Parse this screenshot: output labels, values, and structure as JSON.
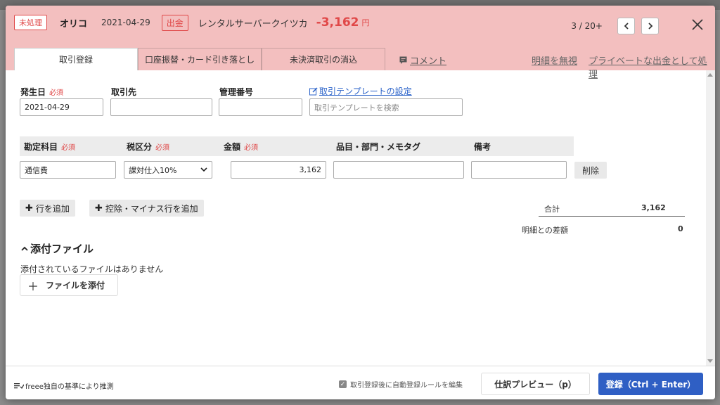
{
  "header": {
    "status_badge": "未処理",
    "partner": "オリコ",
    "date": "2021-04-29",
    "direction": "出金",
    "description": "レンタルサーバークイツカ",
    "amount": "-3,162",
    "currency": "円",
    "pager": "3 / 20+",
    "colors": {
      "header_bg": "#f3bfbf",
      "accent_red": "#e04848"
    }
  },
  "tabs": [
    {
      "label": "取引登録"
    },
    {
      "label": "口座振替・カード引き落とし"
    },
    {
      "label": "未決済取引の消込"
    }
  ],
  "header_links": {
    "comment": "コメント",
    "ignore_detail": "明細を無視",
    "private_expense": "プライベートな出金として処理"
  },
  "form": {
    "required_label": "必須",
    "issue_date_label": "発生日",
    "issue_date_value": "2021-04-29",
    "partner_label": "取引先",
    "partner_value": "",
    "manage_no_label": "管理番号",
    "manage_no_value": "",
    "template_link": "取引テンプレートの設定",
    "template_placeholder": "取引テンプレートを検索"
  },
  "detail_table": {
    "headers": [
      "勘定科目",
      "税区分",
      "金額",
      "品目・部門・メモタグ",
      "備考"
    ],
    "row": {
      "account": "通信費",
      "tax": "課対仕入10%",
      "amount": "3,162",
      "tags": "",
      "note": "",
      "delete": "削除"
    }
  },
  "buttons": {
    "add_row": "行を追加",
    "add_deduction_row": "控除・マイナス行を追加"
  },
  "summary": {
    "total_label": "合計",
    "total_value": "3,162",
    "diff_label": "明細との差額",
    "diff_value": "0"
  },
  "attachments": {
    "title": "添付ファイル",
    "none_text": "添付されているファイルはありません",
    "attach_button": "ファイルを添付"
  },
  "footer": {
    "estimate_note": "freee独自の基準により推測",
    "auto_rule_checkbox": "取引登録後に自動登録ルールを編集",
    "preview_button": "仕訳プレビュー（p）",
    "submit_button": "登録（Ctrl + Enter）",
    "submit_color": "#2f5fc4"
  }
}
